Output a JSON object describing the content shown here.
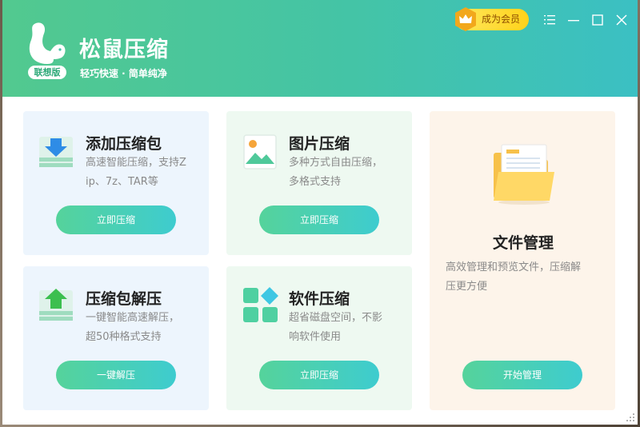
{
  "header": {
    "title": "松鼠压缩",
    "edition_badge": "联想版",
    "slogan": "轻巧快速 · 简单纯净",
    "vip_label": "成为会员"
  },
  "cards": [
    {
      "title": "添加压缩包",
      "desc_line1": "高速智能压缩，支持Z",
      "desc_line2": "ip、7z、TAR等",
      "button": "立即压缩"
    },
    {
      "title": "图片压缩",
      "desc_line1": "多种方式自由压缩，",
      "desc_line2": "多格式支持",
      "button": "立即压缩"
    },
    {
      "title": "文件管理",
      "desc_line1": "高效管理和预览文件，压缩解",
      "desc_line2": "压更方便",
      "button": "开始管理"
    },
    {
      "title": "压缩包解压",
      "desc_line1": "一键智能高速解压，",
      "desc_line2": "超50种格式支持",
      "button": "一键解压"
    },
    {
      "title": "软件压缩",
      "desc_line1": "超省磁盘空间，不影",
      "desc_line2": "响软件使用",
      "button": "立即压缩"
    }
  ],
  "colors": {
    "header_start": "#52c98f",
    "header_end": "#3bc0c3",
    "button_start": "#55d39b",
    "button_end": "#3ecccf",
    "vip": "#ffd21a"
  },
  "icons": [
    "squirrel-logo-icon",
    "crown-icon",
    "menu-icon",
    "minimize-icon",
    "maximize-icon",
    "close-icon",
    "archive-add-icon",
    "image-icon",
    "folder-icon",
    "archive-extract-icon",
    "apps-grid-icon"
  ]
}
